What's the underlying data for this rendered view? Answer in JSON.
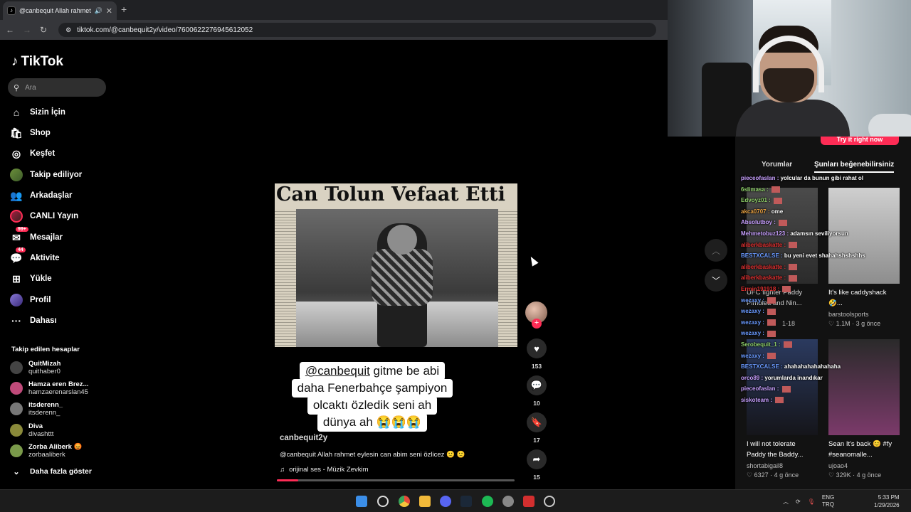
{
  "browser": {
    "tab_title": "@canbequit Allah rahmet e",
    "url": "tiktok.com/@canbequit2y/video/7600622276945612052",
    "new_tab": "+"
  },
  "sidebar": {
    "logo": "TikTok",
    "search_placeholder": "Ara",
    "nav": [
      {
        "label": "Sizin İçin",
        "icon": "home-icon"
      },
      {
        "label": "Shop",
        "icon": "shopping-bag-icon"
      },
      {
        "label": "Keşfet",
        "icon": "compass-icon"
      },
      {
        "label": "Takip ediliyor",
        "icon": "following-avatar"
      },
      {
        "label": "Arkadaşlar",
        "icon": "friends-icon"
      },
      {
        "label": "CANLI Yayın",
        "icon": "live-avatar"
      },
      {
        "label": "Mesajlar",
        "icon": "messages-icon",
        "badge": "99+"
      },
      {
        "label": "Aktivite",
        "icon": "activity-icon",
        "badge": "44"
      },
      {
        "label": "Yükle",
        "icon": "upload-icon"
      },
      {
        "label": "Profil",
        "icon": "profile-avatar"
      },
      {
        "label": "Dahası",
        "icon": "more-icon"
      }
    ],
    "following_header": "Takip edilen hesaplar",
    "accounts": [
      {
        "name": "QuitMizah",
        "handle": "quithaber0"
      },
      {
        "name": "Hamza eren Brez...",
        "handle": "hamzaerenarslan45"
      },
      {
        "name": "itsderenn_",
        "handle": "itsderenn_"
      },
      {
        "name": "Diva",
        "handle": "divashttt"
      },
      {
        "name": "Zorba Aliberk 😡",
        "handle": "zorbaaliberk"
      }
    ],
    "show_more": "Daha fazla göster"
  },
  "video": {
    "headline": "Can Tolun Vefaat Etti",
    "caption_mention": "@canbequit",
    "caption_line1": " gitme be abi",
    "caption_line2": "daha Fenerbahçe şampiyon",
    "caption_line3": "olcaktı özledik seni ah",
    "caption_line4": "dünya ah 😭😭😭",
    "author": "canbequit2y",
    "description": "@canbequit  Allah rahmet eylesin can abim seni özlicez 🙁 🙁",
    "music": "orijinal ses - Müzik Zevkim",
    "progress": 0.09
  },
  "actions": {
    "likes": "153",
    "comments": "10",
    "saves": "17",
    "shares": "15"
  },
  "right_panel": {
    "try_it": "Try it right now",
    "tab_comments": "Yorumlar",
    "tab_like": "Şunları beğenebilirsiniz",
    "videos": [
      {
        "title": "UFC fighter Paddy Pimblett and Nin...",
        "user": "",
        "stats": "1-18"
      },
      {
        "title": "It's like caddyshack 🤣...",
        "user": "barstoolsports",
        "stats": "1.1M · 3 g önce"
      },
      {
        "title": "I will not tolerate Paddy the Baddy...",
        "user": "shortabigail8",
        "stats": "6327 · 4 g önce"
      },
      {
        "title": "Sean It's back 😊 #fy #seanomalle...",
        "user": "ujoao4",
        "stats": "329K · 4 g önce"
      }
    ]
  },
  "chat": [
    {
      "user": "pieceofaslan",
      "msg": "yolcular da bunun gibi rahat ol",
      "color": "#c8a0ff"
    },
    {
      "user": "6slimasa",
      "msg": "",
      "color": "#8fd06a"
    },
    {
      "user": "Edvoyz01",
      "msg": "",
      "color": "#8fd06a"
    },
    {
      "user": "akca0707",
      "msg": "ome",
      "color": "#e8a040"
    },
    {
      "user": "Absolutboy",
      "msg": "",
      "color": "#c8a0ff"
    },
    {
      "user": "Mehmetobuz123",
      "msg": "adamsın seviliyorsun",
      "color": "#c8a0ff"
    },
    {
      "user": "aliberkbaskatte",
      "msg": "",
      "color": "#e03030"
    },
    {
      "user": "BESTXCALSE",
      "msg": "bu yeni evet shahahshshshhs",
      "color": "#6a9aff"
    },
    {
      "user": "aliberkbaskatte",
      "msg": "",
      "color": "#e03030"
    },
    {
      "user": "aliberkbaskatte",
      "msg": "",
      "color": "#e03030"
    },
    {
      "user": "Ermin191918",
      "msg": "",
      "color": "#e03030"
    },
    {
      "user": "wezaxy",
      "msg": "",
      "color": "#6a9aff"
    },
    {
      "user": "wezaxy",
      "msg": "",
      "color": "#6a9aff"
    },
    {
      "user": "wezaxy",
      "msg": "",
      "color": "#6a9aff"
    },
    {
      "user": "wezaxy",
      "msg": "",
      "color": "#6a9aff"
    },
    {
      "user": "Serobequit_1",
      "msg": "",
      "color": "#8fd06a"
    },
    {
      "user": "wezaxy",
      "msg": "",
      "color": "#6a9aff"
    },
    {
      "user": "BESTXCALSE",
      "msg": "ahahahahahahahaha",
      "color": "#6a9aff"
    },
    {
      "user": "orco89",
      "msg": "yorumlarda inandıkar",
      "color": "#c8a0ff"
    },
    {
      "user": "pieceofaslan",
      "msg": "",
      "color": "#c8a0ff"
    },
    {
      "user": "siskoteam",
      "msg": "",
      "color": "#c8a0ff"
    }
  ],
  "taskbar": {
    "lang1": "ENG",
    "lang2": "TRQ",
    "time": "5:33 PM",
    "date": "1/29/2026"
  },
  "colors": {
    "accent": "#fe2c55",
    "background": "#000000",
    "panel": "#121212"
  }
}
